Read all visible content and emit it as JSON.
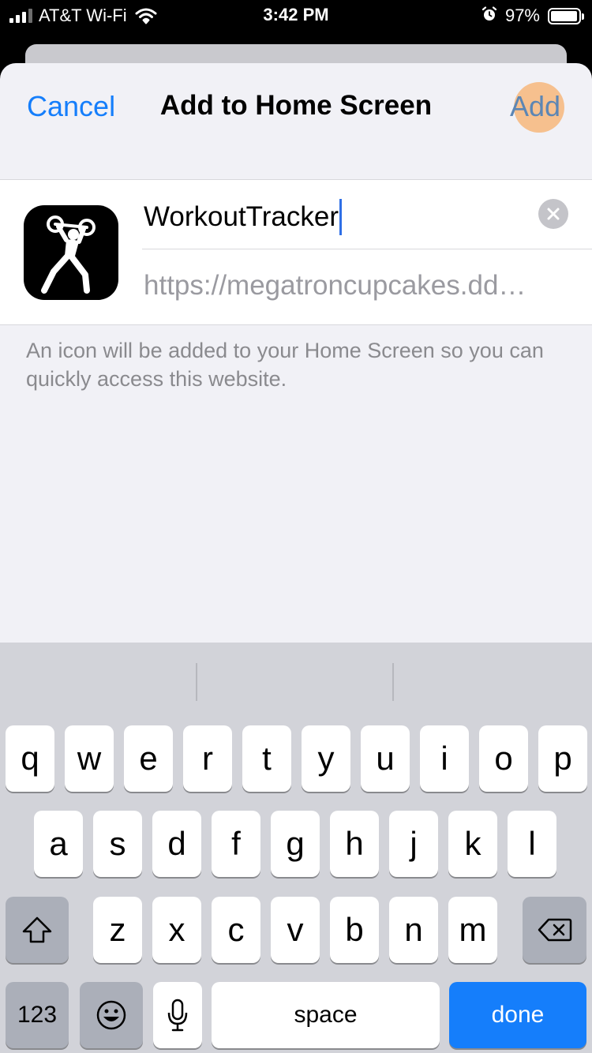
{
  "status_bar": {
    "carrier": "AT&T Wi-Fi",
    "time": "3:42 PM",
    "battery_percent": "97%",
    "battery_level": 0.97,
    "icons": [
      "signal-icon",
      "wifi-icon",
      "alarm-icon",
      "battery-icon"
    ]
  },
  "nav": {
    "cancel_label": "Cancel",
    "title": "Add to Home Screen",
    "add_label": "Add"
  },
  "bookmark": {
    "name_value": "WorkoutTracker",
    "url_value": "https://megatroncupcakes.dd…",
    "icon": "weightlifter-icon",
    "clear_icon": "clear-icon"
  },
  "footer_note": "An icon will be added to your Home Screen so you can quickly access this website.",
  "keyboard": {
    "row1": [
      "q",
      "w",
      "e",
      "r",
      "t",
      "y",
      "u",
      "i",
      "o",
      "p"
    ],
    "row2": [
      "a",
      "s",
      "d",
      "f",
      "g",
      "h",
      "j",
      "k",
      "l"
    ],
    "row3": [
      "z",
      "x",
      "c",
      "v",
      "b",
      "n",
      "m"
    ],
    "numbers_label": "123",
    "space_label": "space",
    "done_label": "done",
    "icons": [
      "shift-icon",
      "backspace-icon",
      "emoji-icon",
      "microphone-icon"
    ]
  },
  "colors": {
    "accent": "#157efb",
    "tap_highlight": "#f6bd88",
    "sheet_background": "#f1f1f6",
    "keyboard_background": "#d2d3d9"
  }
}
